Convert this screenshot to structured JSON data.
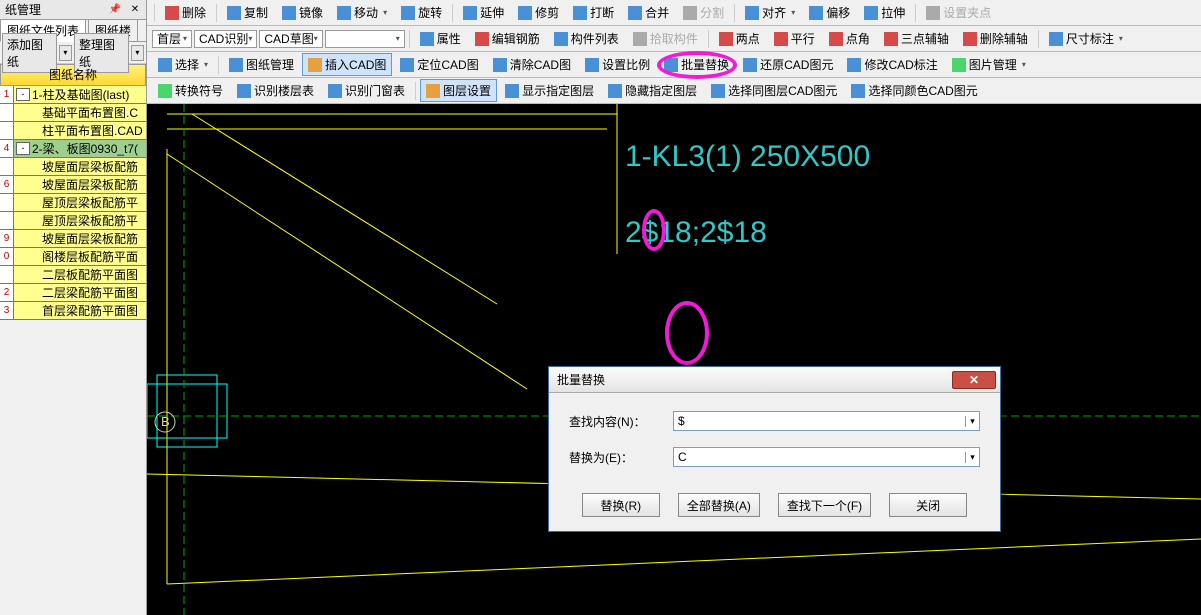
{
  "left_panel": {
    "title": "纸管理",
    "tab1": "图纸文件列表",
    "tab2": "图纸楼",
    "btn_add": "添加图纸",
    "btn_sort": "整理图纸",
    "header": "图纸名称",
    "rows": [
      {
        "num": "1",
        "toggle": "-",
        "text": "1-柱及基础图(last)",
        "indent": false
      },
      {
        "num": "",
        "text": "基础平面布置图.C",
        "indent": true
      },
      {
        "num": "",
        "text": "柱平面布置图.CAD",
        "indent": true
      },
      {
        "num": "4",
        "toggle": "-",
        "text": "2-梁、板图0930_t7(",
        "indent": false,
        "sel": true
      },
      {
        "num": "",
        "text": "坡屋面层梁板配筋",
        "indent": true
      },
      {
        "num": "6",
        "text": "坡屋面层梁板配筋",
        "indent": true
      },
      {
        "num": "",
        "text": "屋顶层梁板配筋平",
        "indent": true
      },
      {
        "num": "",
        "text": "屋顶层梁板配筋平",
        "indent": true
      },
      {
        "num": "9",
        "text": "坡屋面层梁板配筋",
        "indent": true
      },
      {
        "num": "0",
        "text": "阁楼层板配筋平面",
        "indent": true
      },
      {
        "num": "",
        "text": "二层板配筋平面图",
        "indent": true
      },
      {
        "num": "2",
        "text": "二层梁配筋平面图",
        "indent": true
      },
      {
        "num": "3",
        "text": "首层梁配筋平面图",
        "indent": true
      }
    ]
  },
  "tb1": {
    "delete": "删除",
    "copy": "复制",
    "mirror": "镜像",
    "move": "移动",
    "rotate": "旋转",
    "extend": "延伸",
    "trim": "修剪",
    "break": "打断",
    "merge": "合并",
    "split": "分割",
    "align": "对齐",
    "offset": "偏移",
    "stretch": "拉伸",
    "snap": "设置夹点"
  },
  "tb2": {
    "floor": "首层",
    "cad_recog": "CAD识别",
    "cad_sketch": "CAD草图",
    "attr": "属性",
    "edit_rebar": "编辑钢筋",
    "member_list": "构件列表",
    "pick": "拾取构件",
    "two_pt": "两点",
    "parallel": "平行",
    "pt_angle": "点角",
    "three_pt": "三点辅轴",
    "del_axis": "删除辅轴",
    "dim": "尺寸标注"
  },
  "tb3": {
    "select": "选择",
    "mgr": "图纸管理",
    "insert": "插入CAD图",
    "locate": "定位CAD图",
    "clear": "清除CAD图",
    "scale": "设置比例",
    "batch": "批量替换",
    "restore": "还原CAD图元",
    "modify": "修改CAD标注",
    "pic": "图片管理"
  },
  "tb4": {
    "symbol": "转换符号",
    "recog_floor": "识别楼层表",
    "recog_win": "识别门窗表",
    "layer": "图层设置",
    "show_layer": "显示指定图层",
    "hide_layer": "隐藏指定图层",
    "sel_same": "选择同图层CAD图元",
    "sel_color": "选择同颜色CAD图元"
  },
  "cad": {
    "line1": "1-KL3(1) 250X500",
    "line2": "2$18;2$18",
    "point_label": "B"
  },
  "dialog": {
    "title": "批量替换",
    "find_label": "查找内容(N)：",
    "replace_label": "替换为(E)：",
    "find_value": "$",
    "replace_value": "C",
    "btn_replace": "替换(R)",
    "btn_replace_all": "全部替换(A)",
    "btn_find_next": "查找下一个(F)",
    "btn_close": "关闭"
  }
}
